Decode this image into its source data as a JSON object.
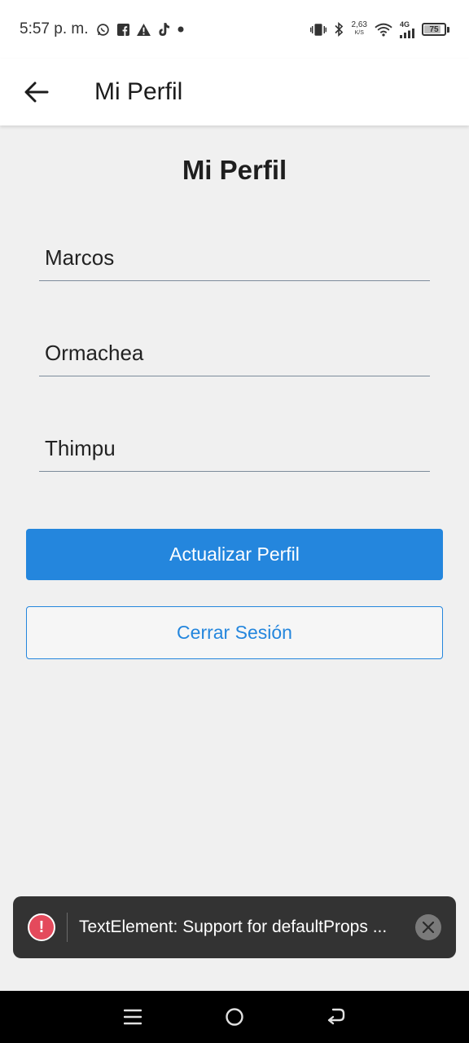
{
  "status_bar": {
    "time": "5:57 p. m.",
    "net_speed_value": "2,63",
    "net_speed_unit": "K/S",
    "network_type": "4G",
    "battery_level": "75",
    "left_icons": [
      "whatsapp-icon",
      "facebook-icon",
      "warning-icon",
      "tiktok-icon",
      "dot-icon"
    ],
    "right_icons": [
      "vibrate-icon",
      "bluetooth-icon",
      "wifi-icon",
      "signal-icon",
      "battery-icon"
    ]
  },
  "app_bar": {
    "title": "Mi Perfil",
    "back_icon": "arrow-left-icon"
  },
  "main": {
    "title": "Mi Perfil",
    "fields": {
      "first_name": "Marcos",
      "last_name": "Ormachea",
      "city": "Thimpu"
    },
    "update_button": "Actualizar Perfil",
    "logout_button": "Cerrar Sesión"
  },
  "toast": {
    "message": "TextElement: Support for defaultProps ...",
    "icon": "error-icon",
    "close_icon": "close-icon"
  },
  "nav_bar": {
    "icons": [
      "menu-icon",
      "home-icon",
      "back-icon"
    ]
  },
  "colors": {
    "accent": "#2486dd",
    "background": "#f0f0f0",
    "toast_bg": "#333333",
    "error": "#e44a5c"
  }
}
